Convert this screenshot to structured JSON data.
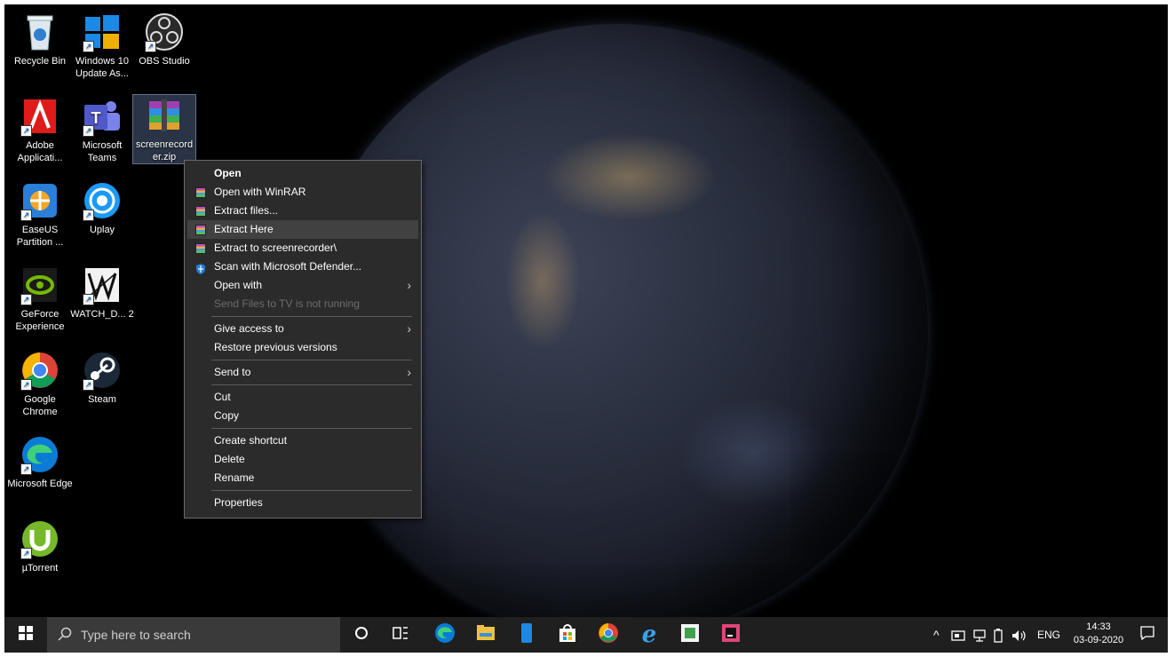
{
  "desktop_icons": [
    {
      "label": "Recycle Bin"
    },
    {
      "label": "Windows 10 Update As..."
    },
    {
      "label": "OBS Studio"
    },
    {
      "label": "Adobe Applicati..."
    },
    {
      "label": "Microsoft Teams"
    },
    {
      "label": "screenrecorder.zip"
    },
    {
      "label": "EaseUS Partition ..."
    },
    {
      "label": "Uplay"
    },
    {
      "label": "GeForce Experience"
    },
    {
      "label": "WATCH_D... 2"
    },
    {
      "label": "Google Chrome"
    },
    {
      "label": "Steam"
    },
    {
      "label": "Microsoft Edge"
    },
    {
      "label": "µTorrent"
    }
  ],
  "context_menu": {
    "items": [
      {
        "label": "Open"
      },
      {
        "label": "Open with WinRAR"
      },
      {
        "label": "Extract files..."
      },
      {
        "label": "Extract Here"
      },
      {
        "label": "Extract to screenrecorder\\"
      },
      {
        "label": "Scan with Microsoft Defender..."
      },
      {
        "label": "Open with"
      },
      {
        "label": "Send Files to TV is not running"
      },
      {
        "label": "Give access to"
      },
      {
        "label": "Restore previous versions"
      },
      {
        "label": "Send to"
      },
      {
        "label": "Cut"
      },
      {
        "label": "Copy"
      },
      {
        "label": "Create shortcut"
      },
      {
        "label": "Delete"
      },
      {
        "label": "Rename"
      },
      {
        "label": "Properties"
      }
    ],
    "submenu_arrow": "›"
  },
  "taskbar": {
    "search_placeholder": "Type here to search",
    "language": "ENG",
    "time": "14:33",
    "date": "03-09-2020"
  },
  "colors": {
    "menu_bg": "#2b2b2b",
    "menu_hover": "#414141",
    "taskbar_bg": "#1f1f1f",
    "search_bg": "#3a3a3a"
  }
}
